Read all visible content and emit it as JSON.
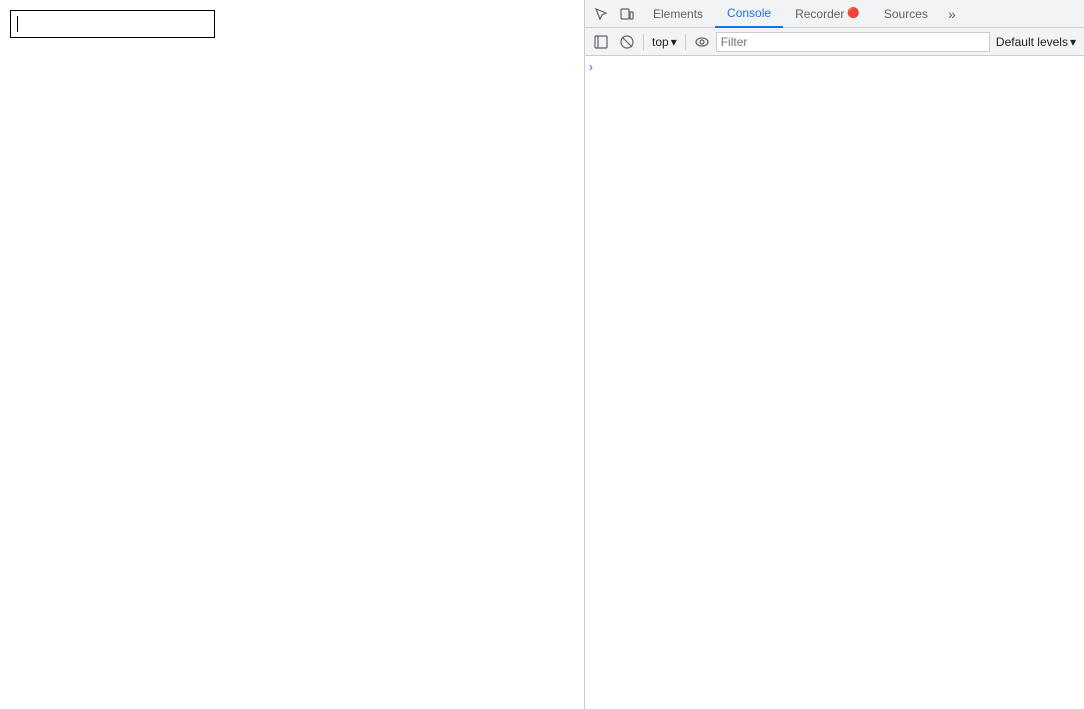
{
  "webpage": {
    "input_placeholder": ""
  },
  "devtools": {
    "tabs": [
      {
        "label": "Elements",
        "active": false
      },
      {
        "label": "Console",
        "active": true
      },
      {
        "label": "Recorder",
        "active": false
      },
      {
        "label": "Sources",
        "active": false
      }
    ],
    "more_tabs_label": "»",
    "console_toolbar": {
      "top_label": "top",
      "top_dropdown_icon": "▾",
      "filter_placeholder": "Filter",
      "default_levels_label": "Default levels",
      "default_levels_dropdown_icon": "▾"
    },
    "console_prompt_chevron": "›"
  },
  "icons": {
    "cursor_icon": "⊹",
    "layout_icon": "⬜",
    "sidebar_left_icon": "▣",
    "ban_icon": "⊘",
    "eye_icon": "👁",
    "more_icon": "»"
  }
}
